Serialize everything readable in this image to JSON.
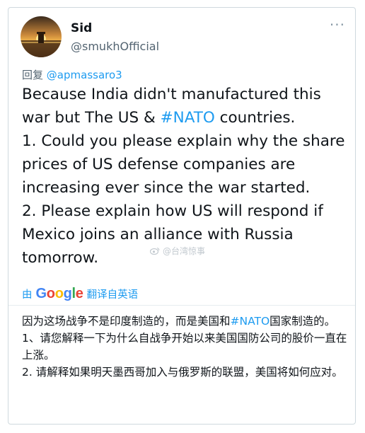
{
  "author": {
    "name": "Sid",
    "handle": "@smukhOfficial",
    "avatar_icon": "sunset-avatar"
  },
  "more_icon": "more-dots-icon",
  "reply": {
    "prefix": "回复",
    "mention": "@apmassaro3"
  },
  "tweet": {
    "line1_before": "Because India didn't manufactured this war but The US & ",
    "hashtag": "#NATO",
    "line1_after": " countries.",
    "point1": "1. Could you please explain why the share prices of US defense companies are increasing ever since the war started.",
    "point2": "2. Please explain how US will respond if Mexico joins an alliance with Russia tomorrow."
  },
  "watermark": {
    "icon": "weibo-icon",
    "text": "@台湾惊事"
  },
  "translation": {
    "by": "由",
    "provider": "Google",
    "label": "翻译自英语",
    "line1_before": "因为这场战争不是印度制造的，而是美国和",
    "hashtag": "#NATO",
    "line1_after": "国家制造的。",
    "point1": "1、请您解释一下为什么自战争开始以来美国国防公司的股价一直在上涨。",
    "point2": "2. 请解释如果明天墨西哥加入与俄罗斯的联盟，美国将如何应对。"
  },
  "colors": {
    "accent": "#1d9bf0",
    "text": "#0f1419",
    "secondary": "#536471",
    "border": "#cfd9de"
  }
}
